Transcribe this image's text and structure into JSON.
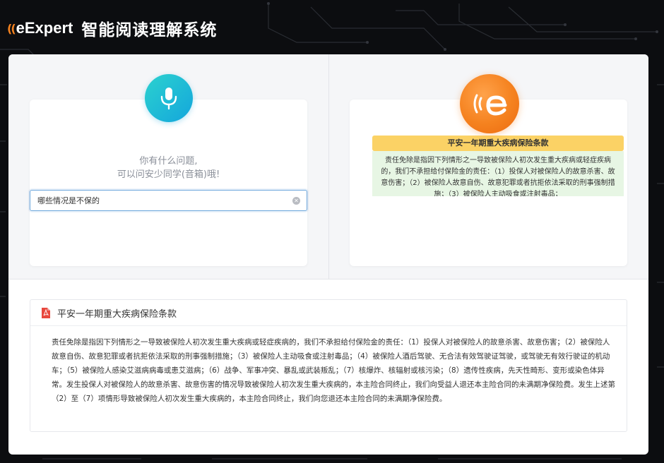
{
  "header": {
    "logo_text": "eExpert",
    "app_title": "智能阅读理解系统"
  },
  "question_panel": {
    "prompt_line1": "你有什么问题,",
    "prompt_line2": "可以问安少同学(音箱)哦!",
    "input_value": "哪些情况是不保的"
  },
  "answer_panel": {
    "clause_title": "平安一年期重大疾病保险条款",
    "clause_excerpt": "责任免除是指因下列情形之一导致被保险人初次发生重大疾病或轻症疾病的，我们不承担给付保险金的责任：（1）投保人对被保险人的故意杀害、故意伤害；（2）被保险人故意自伤、故意犯罪或者抗拒依法采取的刑事强制措施；（3）被保险人主动吸食或注射毒品；"
  },
  "document": {
    "title": "平安一年期重大疾病保险条款",
    "body": "责任免除是指因下列情形之一导致被保险人初次发生重大疾病或轻症疾病的，我们不承担给付保险金的责任：（1）投保人对被保险人的故意杀害、故意伤害；（2）被保险人故意自伤、故意犯罪或者抗拒依法采取的刑事强制措施；（3）被保险人主动吸食或注射毒品；（4）被保险人酒后驾驶、无合法有效驾驶证驾驶，或驾驶无有效行驶证的机动车；（5）被保险人感染艾滋病病毒或患艾滋病；（6）战争、军事冲突、暴乱或武装叛乱；（7）核爆炸、核辐射或核污染；（8）遗传性疾病，先天性畸形、变形或染色体异常。发生投保人对被保险人的故意杀害、故意伤害的情况导致被保险人初次发生重大疾病的，本主险合同终止，我们向受益人退还本主险合同的未满期净保险费。发生上述第（2）至（7）项情形导致被保险人初次发生重大疾病的，本主险合同终止，我们向您退还本主险合同的未满期净保险费。"
  },
  "colors": {
    "accent_orange": "#f5821f",
    "mic_teal": "#14a6dc",
    "title_yellow": "#fbd265",
    "excerpt_green": "#e7f6e4",
    "pdf_red": "#e8473d"
  }
}
